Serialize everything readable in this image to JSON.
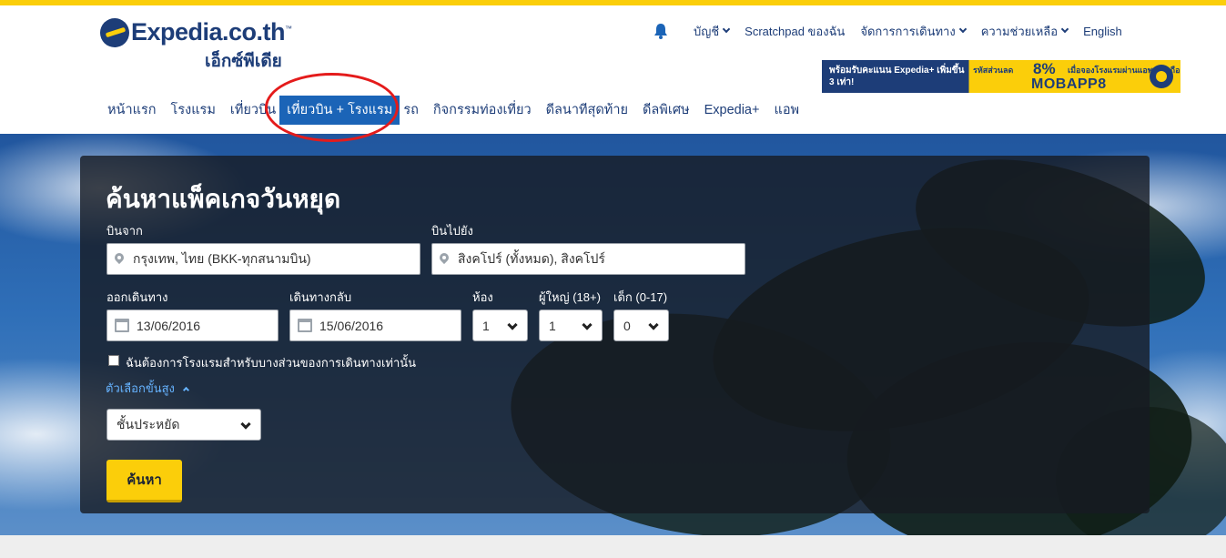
{
  "brand": {
    "logo_text": "Expedia.co.th",
    "logo_sub": "เอ็กซ์พีเดีย",
    "accent": "#fbce0a",
    "brand_blue": "#1d3d78",
    "active_tab_color": "#1b64b7"
  },
  "util_nav": {
    "bell_icon": "bell-icon",
    "items": [
      {
        "label": "บัญชี",
        "dropdown": true
      },
      {
        "label": "Scratchpad ของฉัน",
        "dropdown": false
      },
      {
        "label": "จัดการการเดินทาง",
        "dropdown": true
      },
      {
        "label": "ความช่วยเหลือ",
        "dropdown": true
      },
      {
        "label": "English",
        "dropdown": false
      }
    ]
  },
  "promo": {
    "left_text": "พร้อมรับคะแนน Expedia+ เพิ่มขึ้น 3 เท่า!",
    "code_label": "รหัสส่วนลด",
    "percent": "8%",
    "desc": "เมื่อจองโรงแรมผ่านแอพฯ มือถือ",
    "code": "MOBAPP8"
  },
  "main_nav": {
    "items": [
      "หน้าแรก",
      "โรงแรม",
      "เที่ยวบิน",
      "เที่ยวบิน + โรงแรม",
      "รถ",
      "กิจกรรมท่องเที่ยว",
      "ดีลนาทีสุดท้าย",
      "ดีลพิเศษ",
      "Expedia+",
      "แอพ"
    ],
    "active_index": 3
  },
  "search": {
    "title": "ค้นหาแพ็คเกจวันหยุด",
    "from_label": "บินจาก",
    "from_value": "กรุงเทพ, ไทย (BKK-ทุกสนามบิน)",
    "to_label": "บินไปยัง",
    "to_value": "สิงคโปร์ (ทั้งหมด), สิงคโปร์",
    "depart_label": "ออกเดินทาง",
    "depart_value": "13/06/2016",
    "return_label": "เดินทางกลับ",
    "return_value": "15/06/2016",
    "rooms_label": "ห้อง",
    "rooms_value": "1",
    "adults_label": "ผู้ใหญ่ (18+)",
    "adults_value": "1",
    "children_label": "เด็ก (0-17)",
    "children_value": "0",
    "partial_hotel_label": "ฉันต้องการโรงแรมสำหรับบางส่วนของการเดินทางเท่านั้น",
    "partial_hotel_checked": false,
    "advanced_label": "ตัวเลือกขั้นสูง",
    "cabin_value": "ชั้นประหยัด",
    "submit_label": "ค้นหา"
  }
}
